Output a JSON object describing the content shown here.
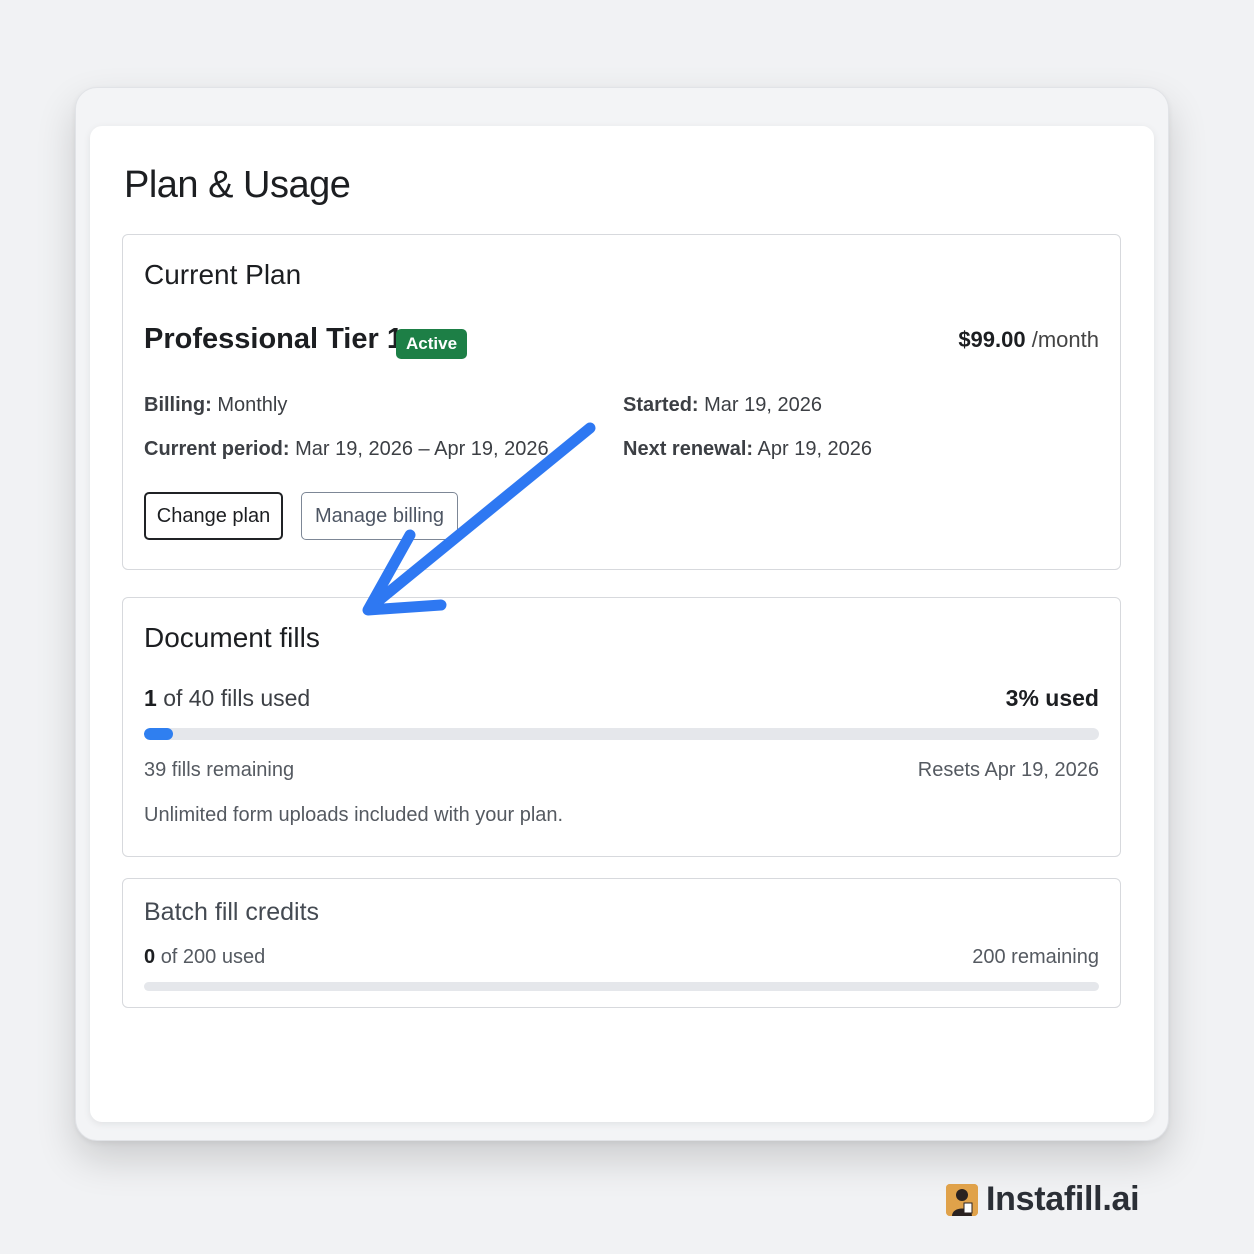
{
  "page": {
    "title": "Plan & Usage"
  },
  "current_plan": {
    "section_title": "Current Plan",
    "plan_name": "Professional Tier 1",
    "status_badge": "Active",
    "price": "$99.00",
    "price_unit": "/month",
    "billing_label": "Billing:",
    "billing_value": "Monthly",
    "started_label": "Started:",
    "started_value": "Mar 19, 2026",
    "period_label": "Current period:",
    "period_value": "Mar 19, 2026 – Apr 19, 2026",
    "renewal_label": "Next renewal:",
    "renewal_value": "Apr 19, 2026",
    "change_plan_label": "Change plan",
    "manage_billing_label": "Manage billing"
  },
  "document_fills": {
    "section_title": "Document fills",
    "used_count": "1",
    "used_of_text": "of 40 fills used",
    "percent_used_text": "3% used",
    "progress_fraction": 0.03,
    "remaining_text": "39 fills remaining",
    "resets_text": "Resets Apr 19, 2026",
    "note": "Unlimited form uploads included with your plan."
  },
  "batch_fill_credits": {
    "section_title": "Batch fill credits",
    "used_count": "0",
    "used_of_text": "of 200 used",
    "remaining_text": "200 remaining",
    "progress_fraction": 0
  },
  "brand": {
    "name": "Instafill.ai"
  },
  "colors": {
    "accent_blue": "#2f7ff0",
    "active_badge_green": "#1d7f46",
    "annotation_arrow": "#2e78f2"
  }
}
